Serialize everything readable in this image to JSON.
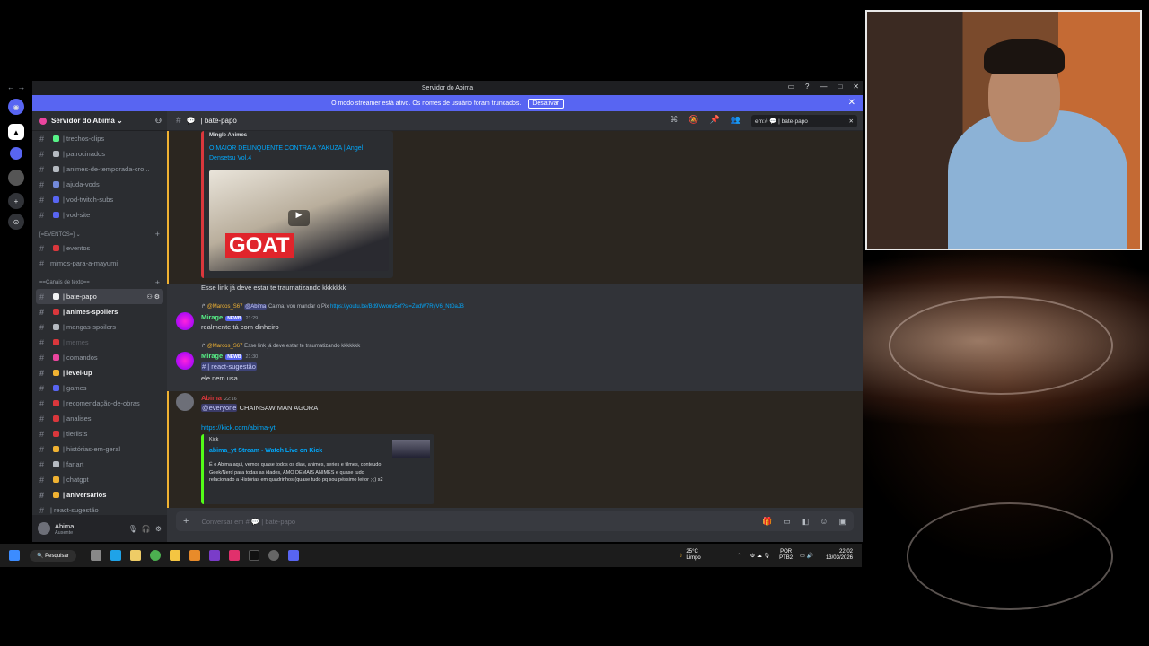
{
  "window": {
    "title": "Servidor do Abima"
  },
  "banner": {
    "text": "O modo streamer está ativo. Os nomes de usuário foram truncados.",
    "button": "Desativar"
  },
  "server": {
    "name": "Servidor do Abima ⌄"
  },
  "channels_top": [
    {
      "name": "| trechos-clips",
      "color": "#57f287"
    },
    {
      "name": "| patrocinados",
      "color": "#b5bac1"
    },
    {
      "name": "| animes-de-temporada-cro...",
      "color": "#b5bac1"
    },
    {
      "name": "| ajuda-vods",
      "color": "#7289da"
    },
    {
      "name": "| vod-twitch-subs",
      "color": "#5865f2"
    },
    {
      "name": "| vod-site",
      "color": "#5865f2"
    }
  ],
  "category_events": "[=EVENTOS=] ⌄",
  "channels_events": [
    {
      "name": "| eventos",
      "color": "#da373c"
    },
    {
      "name": "mimos-para-a-mayumi",
      "color": ""
    }
  ],
  "category_text": "==Canais de texto==",
  "channels_text": [
    {
      "name": "| bate-papo",
      "state": "active",
      "color": "#f2f3f5"
    },
    {
      "name": "| animes-spoilers",
      "state": "unread",
      "color": "#da373c"
    },
    {
      "name": "| mangas-spoilers",
      "state": "",
      "color": "#b5bac1"
    },
    {
      "name": "| memes",
      "state": "muted",
      "color": "#da373c"
    },
    {
      "name": "| comandos",
      "state": "",
      "color": "#eb459e"
    },
    {
      "name": "| level-up",
      "state": "unread",
      "color": "#f0b232"
    },
    {
      "name": "| games",
      "state": "",
      "color": "#5865f2"
    },
    {
      "name": "| recomendação-de-obras",
      "state": "",
      "color": "#da373c"
    },
    {
      "name": "| analises",
      "state": "",
      "color": "#da373c"
    },
    {
      "name": "| tierlists",
      "state": "",
      "color": "#da373c"
    },
    {
      "name": "| histórias-em-geral",
      "state": "",
      "color": "#f0b232"
    },
    {
      "name": "| fanart",
      "state": "",
      "color": "#b5bac1"
    },
    {
      "name": "| chatgpt",
      "state": "",
      "color": "#f0b232"
    },
    {
      "name": "| aniversarios",
      "state": "unread",
      "color": "#f0b232"
    },
    {
      "name": "| react-sugestão",
      "state": "",
      "color": ""
    }
  ],
  "user": {
    "name": "Abima",
    "status": "Ausente"
  },
  "channel": {
    "name": "| bate-papo",
    "search": "em:# 💬 | bate-papo"
  },
  "messages": {
    "embed1": {
      "provider": "Mingle Animes",
      "title": "O MAIOR DELINQUENTE CONTRA A YAKUZA | Angel Densetsu Vol.4",
      "thumb_text": "GOAT"
    },
    "line1": "Esse link já deve estar te traumatizando kkkkkkk",
    "m2_reply_user": "@Marcos_S67",
    "m2_reply_mention": "@Abima",
    "m2_reply_text": "Calma, vou mandar o Pix",
    "m2_reply_link": "https://youtu.be/Bd9Vwouv5ef?si=ZudW7RyV6_NtDaJB",
    "m2_user": "Mirage",
    "m2_tag": "NEWB",
    "m2_time": "21:29",
    "m2_text": "realmente tá com dinheiro",
    "m3_reply_user": "@Marcos_S67",
    "m3_reply_text": "Esse link já deve estar te traumatizando kkkkkkk",
    "m3_user": "Mirage",
    "m3_tag": "NEWB",
    "m3_time": "21:30",
    "m3_channel": "#  | react-sugestão",
    "m3_text": "ele nem usa",
    "m4_user": "Abima",
    "m4_time": "22:16",
    "m4_mention": "@everyone",
    "m4_text": "CHAINSAW MAN AGORA",
    "m4_link": "https://kick.com/abima-yt",
    "embed2": {
      "provider": "Kick",
      "title": "abima_yt Stream - Watch Live on Kick",
      "desc": "É o Abima aqui, vemos quase todos os dias, animes, series e filmes, conteudo Geek/Nerd para todas as idades, AMO DEMAIS ANIMES e quase tudo relacionado a Histórias em quadrinhos (quase tudo pq sou péssimo leitor ;-;) s2"
    }
  },
  "input": {
    "placeholder": "Conversar em # 💬 | bate-papo"
  },
  "taskbar": {
    "search": "Pesquisar",
    "temp": "25°C",
    "weather": "Limpo",
    "lang1": "POR",
    "lang2": "PTB2",
    "time": "22:02",
    "date": "13/03/2026"
  },
  "colors": {
    "banner": "#5865f2",
    "mirage": "#57f287",
    "abima": "#da373c",
    "link": "#00a8fc"
  }
}
